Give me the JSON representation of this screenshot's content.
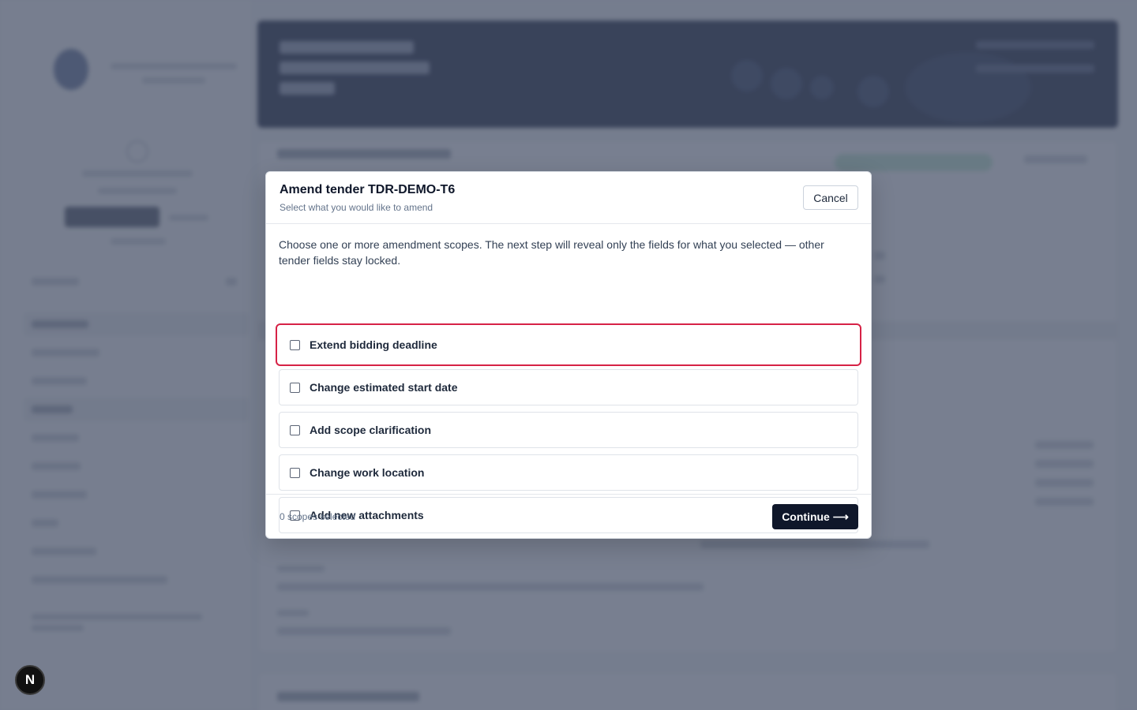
{
  "modal": {
    "title": "Amend tender TDR-DEMO-T6",
    "subtitle": "Select what you would like to amend",
    "cancel_label": "Cancel",
    "intro": "Choose one or more amendment scopes. The next step will reveal only the fields for what you selected — other tender fields stay locked.",
    "options": [
      {
        "label": "Extend bidding deadline",
        "checked": false,
        "focused": true
      },
      {
        "label": "Change estimated start date",
        "checked": false,
        "focused": false
      },
      {
        "label": "Add scope clarification",
        "checked": false,
        "focused": false
      },
      {
        "label": "Change work location",
        "checked": false,
        "focused": false
      },
      {
        "label": "Add new attachments",
        "checked": false,
        "focused": false
      }
    ],
    "selected_count": "0 scopes selected",
    "continue_label": "Continue ⟶"
  },
  "badge": {
    "letter": "N"
  },
  "colors": {
    "primary": "#0f172a",
    "focus_ring": "#d62246",
    "scrim": "#475066"
  }
}
